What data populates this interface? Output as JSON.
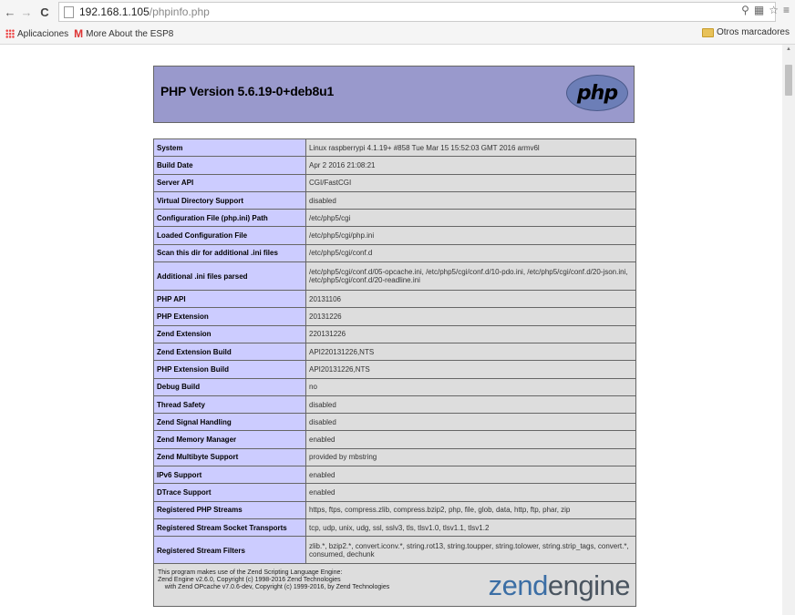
{
  "browser": {
    "url_host": "192.168.1.105",
    "url_path": "/phpinfo.php",
    "bookmarks": [
      {
        "label": "Aplicaciones",
        "icon": "apps-icon"
      },
      {
        "label": "More About the ESP8",
        "icon": "gmail-icon"
      }
    ],
    "other_bookmarks": "Otros marcadores"
  },
  "phpinfo": {
    "title": "PHP Version 5.6.19-0+deb8u1",
    "logo_text": "php",
    "rows": [
      {
        "key": "System",
        "value": "Linux raspberrypi 4.1.19+ #858 Tue Mar 15 15:52:03 GMT 2016 armv6l"
      },
      {
        "key": "Build Date",
        "value": "Apr 2 2016 21:08:21"
      },
      {
        "key": "Server API",
        "value": "CGI/FastCGI"
      },
      {
        "key": "Virtual Directory Support",
        "value": "disabled"
      },
      {
        "key": "Configuration File (php.ini) Path",
        "value": "/etc/php5/cgi"
      },
      {
        "key": "Loaded Configuration File",
        "value": "/etc/php5/cgi/php.ini"
      },
      {
        "key": "Scan this dir for additional .ini files",
        "value": "/etc/php5/cgi/conf.d"
      },
      {
        "key": "Additional .ini files parsed",
        "value": "/etc/php5/cgi/conf.d/05-opcache.ini, /etc/php5/cgi/conf.d/10-pdo.ini, /etc/php5/cgi/conf.d/20-json.ini, /etc/php5/cgi/conf.d/20-readline.ini"
      },
      {
        "key": "PHP API",
        "value": "20131106"
      },
      {
        "key": "PHP Extension",
        "value": "20131226"
      },
      {
        "key": "Zend Extension",
        "value": "220131226"
      },
      {
        "key": "Zend Extension Build",
        "value": "API220131226,NTS"
      },
      {
        "key": "PHP Extension Build",
        "value": "API20131226,NTS"
      },
      {
        "key": "Debug Build",
        "value": "no"
      },
      {
        "key": "Thread Safety",
        "value": "disabled"
      },
      {
        "key": "Zend Signal Handling",
        "value": "disabled"
      },
      {
        "key": "Zend Memory Manager",
        "value": "enabled"
      },
      {
        "key": "Zend Multibyte Support",
        "value": "provided by mbstring"
      },
      {
        "key": "IPv6 Support",
        "value": "enabled"
      },
      {
        "key": "DTrace Support",
        "value": "enabled"
      },
      {
        "key": "Registered PHP Streams",
        "value": "https, ftps, compress.zlib, compress.bzip2, php, file, glob, data, http, ftp, phar, zip"
      },
      {
        "key": "Registered Stream Socket Transports",
        "value": "tcp, udp, unix, udg, ssl, sslv3, tls, tlsv1.0, tlsv1.1, tlsv1.2"
      },
      {
        "key": "Registered Stream Filters",
        "value": "zlib.*, bzip2.*, convert.iconv.*, string.rot13, string.toupper, string.tolower, string.strip_tags, convert.*, consumed, dechunk"
      }
    ],
    "zend_text": "This program makes use of the Zend Scripting Language Engine:\nZend Engine v2.6.0, Copyright (c) 1998-2016 Zend Technologies\n    with Zend OPcache v7.0.6-dev, Copyright (c) 1999-2016, by Zend Technologies",
    "zend_logo_1": "zend",
    "zend_logo_2": "engine"
  }
}
